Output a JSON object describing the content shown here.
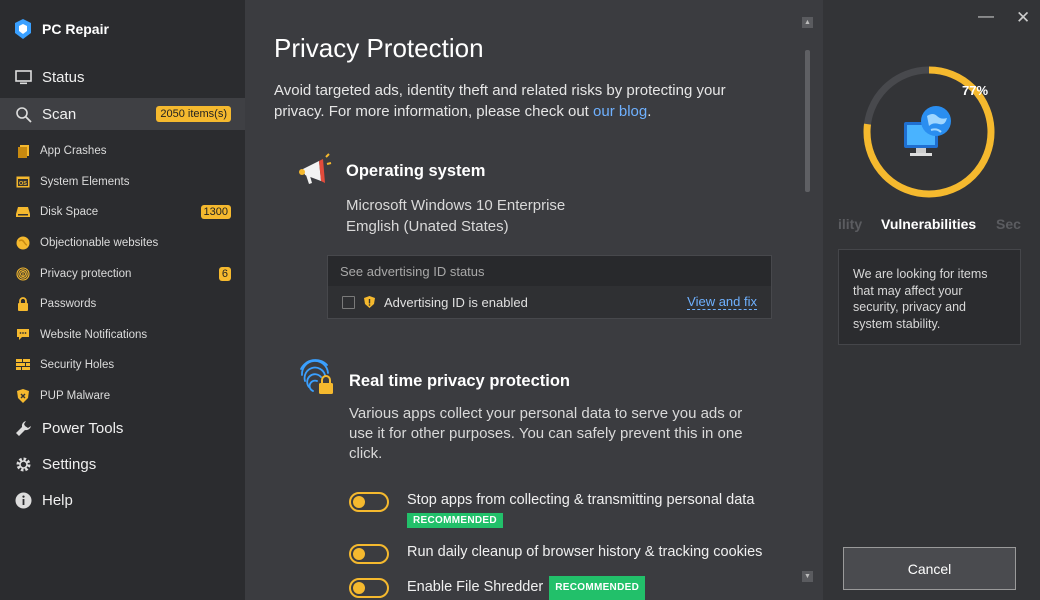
{
  "app": {
    "name": "PC Repair"
  },
  "nav": {
    "status": "Status",
    "scan": {
      "label": "Scan",
      "badge": "2050 items(s)"
    },
    "sub": [
      {
        "label": "App Crashes",
        "icon": "document-icon",
        "badge": ""
      },
      {
        "label": "System Elements",
        "icon": "os-icon",
        "badge": ""
      },
      {
        "label": "Disk Space",
        "icon": "disk-icon",
        "badge": "1300"
      },
      {
        "label": "Objectionable websites",
        "icon": "globe-icon",
        "badge": ""
      },
      {
        "label": "Privacy protection",
        "icon": "fingerprint-icon",
        "badge": "6"
      },
      {
        "label": "Passwords",
        "icon": "lock-icon",
        "badge": ""
      },
      {
        "label": "Website Notifications",
        "icon": "chat-icon",
        "badge": ""
      },
      {
        "label": "Security Holes",
        "icon": "bricks-icon",
        "badge": ""
      },
      {
        "label": "PUP Malware",
        "icon": "shield-x-icon",
        "badge": ""
      }
    ],
    "power_tools": "Power Tools",
    "settings": "Settings",
    "help": "Help"
  },
  "main": {
    "title": "Privacy Protection",
    "intro": "Avoid targeted ads, identity theft and related risks by protecting your privacy. For more information, please check out ",
    "intro_link": "our blog",
    "intro_end": ".",
    "os": {
      "title": "Operating system",
      "line1": "Microsoft Windows 10 Enterprise",
      "line2": "Emglish (Unated States)"
    },
    "ad_box": {
      "header": "See advertising ID status",
      "item": "Advertising ID is enabled",
      "action": "View and fix"
    },
    "realtime": {
      "title": "Real time privacy protection",
      "desc": "Various apps collect your personal data to serve you ads or use it for other purposes. You can safely prevent this in one click."
    },
    "toggles": [
      {
        "label": "Stop apps from collecting & transmitting personal data",
        "badge": "RECOMMENDED"
      },
      {
        "label": "Run daily cleanup of browser history & tracking cookies",
        "badge": ""
      },
      {
        "label": "Enable File Shredder",
        "badge": "RECOMMENDED"
      }
    ]
  },
  "right": {
    "progress": 77,
    "progress_label": "77%",
    "carousel_prev": "ility",
    "carousel_current": "Vulnerabilities",
    "carousel_next": "Sec",
    "info": "We are looking for items that may affect your security, privacy and system stability.",
    "cancel": "Cancel"
  },
  "colors": {
    "accent": "#f5b92e",
    "recommended": "#22c06a",
    "link": "#6fb1ff",
    "sidebar_bg": "#2b2c2f",
    "main_bg": "#3b3c40"
  }
}
